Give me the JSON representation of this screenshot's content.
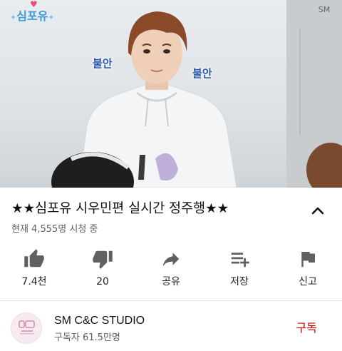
{
  "video": {
    "logo_text": "심포유",
    "corner_mark": "SM",
    "caption_left": "불안",
    "caption_right": "불안"
  },
  "title": "★★심포유 시우민편 실시간 정주행★★",
  "view_count": "현재 4,555명 시청 중",
  "actions": [
    {
      "icon": "thumbs-up-icon",
      "label": "7.4천"
    },
    {
      "icon": "thumbs-down-icon",
      "label": "20"
    },
    {
      "icon": "share-icon",
      "label": "공유"
    },
    {
      "icon": "playlist-add-icon",
      "label": "저장"
    },
    {
      "icon": "flag-icon",
      "label": "신고"
    }
  ],
  "channel": {
    "name": "SM C&C STUDIO",
    "subscribers": "구독자 61.5만명",
    "subscribe_label": "구독"
  },
  "colors": {
    "subscribe": "#cc0000",
    "icon": "#606060",
    "caption": "#2d5aa8"
  }
}
